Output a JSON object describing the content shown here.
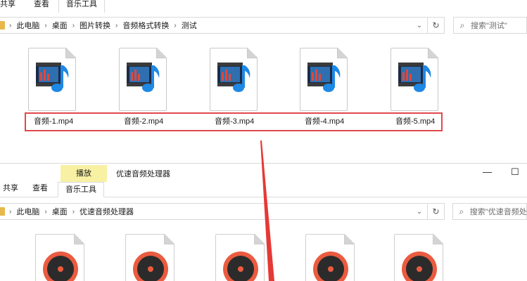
{
  "window1": {
    "ribbon_tabs": [
      "共享",
      "查看",
      "音乐工具"
    ],
    "breadcrumb": [
      "此电脑",
      "桌面",
      "图片转换",
      "音频格式转换",
      "测试"
    ],
    "search_placeholder": "搜索\"测试\"",
    "files": [
      "音频-1.mp4",
      "音频-2.mp4",
      "音频-3.mp4",
      "音频-4.mp4",
      "音频-5.mp4"
    ]
  },
  "window2": {
    "context_tab": "播放",
    "title": "优速音频处理器",
    "minimize_glyph": "—",
    "maximize_glyph": "☐",
    "ribbon_tabs": [
      "共享",
      "查看",
      "音乐工具"
    ],
    "breadcrumb": [
      "此电脑",
      "桌面",
      "优速音频处理器"
    ],
    "search_placeholder": "搜索\"优速音频处"
  },
  "glyphs": {
    "chevron": "⌄",
    "refresh": "↻",
    "search": "⌕",
    "sep": "›"
  },
  "colors": {
    "selection": "#e1484c",
    "context_tab": "#f8f1a4",
    "disc_orange": "#ea5b3f",
    "arrow": "#e53935"
  }
}
